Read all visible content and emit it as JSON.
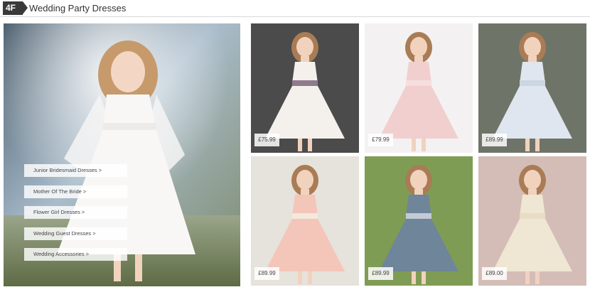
{
  "header": {
    "floor_label": "4F",
    "title": "Wedding Party Dresses"
  },
  "hero": {
    "links": [
      {
        "label": "Junior Bridesmaid Dresses >"
      },
      {
        "label": "Mother Of The Bride >"
      },
      {
        "label": "Flower Girl Dresses >"
      },
      {
        "label": "Wedding Guest Dresses >"
      },
      {
        "label": "Wedding Accessories >"
      }
    ]
  },
  "products": [
    {
      "price": "£75.99",
      "bg": "#4b4b4b",
      "dress": "#f4f1ec",
      "sash": "#8f7a8f"
    },
    {
      "price": "£79.99",
      "bg": "#f4f1f2",
      "dress": "#f1cfcf",
      "sash": "#f6dede"
    },
    {
      "price": "£89.99",
      "bg": "#6f7468",
      "dress": "#dfe6ef",
      "sash": "#cbd6e3"
    },
    {
      "price": "£89.99",
      "bg": "#e6e2dc",
      "dress": "#f4c5b9",
      "sash": "#f3e9dc"
    },
    {
      "price": "£89.99",
      "bg": "#7f9c55",
      "dress": "#6f8599",
      "sash": "#c2cad6"
    },
    {
      "price": "£89.00",
      "bg": "#d4bdb7",
      "dress": "#efe6d3",
      "sash": "#e9dcc4"
    }
  ]
}
